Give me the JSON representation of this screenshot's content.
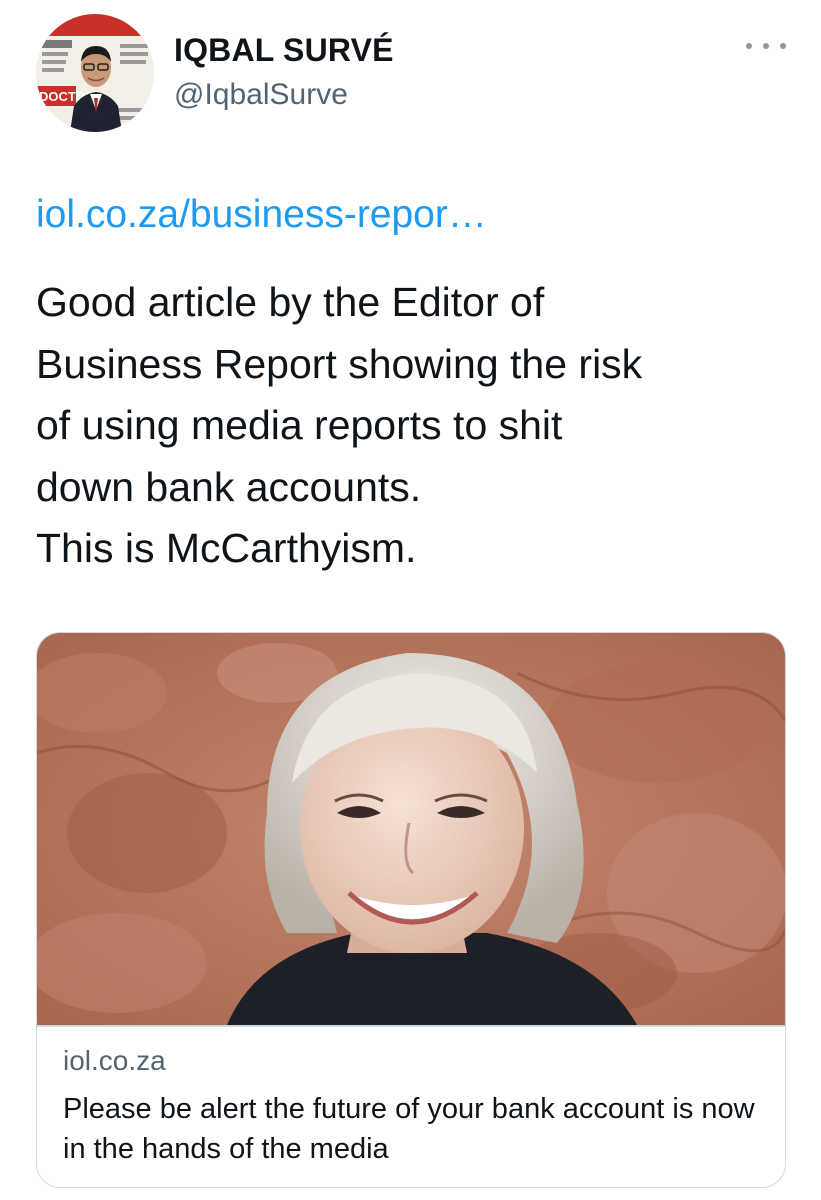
{
  "author": {
    "display_name": "IQBAL SURVÉ",
    "handle": "@IqbalSurve",
    "avatar_icon": "profile-photo-magazine-cover",
    "avatar_cover_text": "DOCTOR"
  },
  "menu_icon": "more-horizontal-icon",
  "tweet": {
    "link_text": "iol.co.za/business-repor…",
    "lines": [
      "Good article by the Editor of",
      "Business Report showing the risk",
      "of using media reports to shit",
      "down bank accounts.",
      "This is McCarthyism."
    ]
  },
  "card": {
    "image_icon": "article-photo-woman",
    "domain": "iol.co.za",
    "title": "Please be alert the future of your bank account is now in the hands of the media"
  },
  "colors": {
    "link": "#1d9bf0",
    "text": "#0f1419",
    "secondary": "#536471",
    "border": "#cfd9de"
  }
}
